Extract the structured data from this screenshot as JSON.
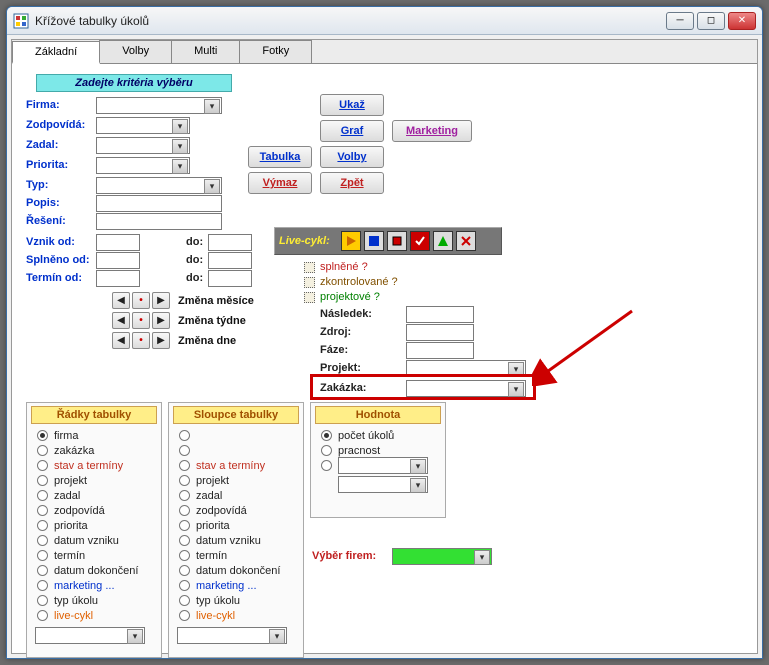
{
  "window": {
    "title": "Křížové tabulky úkolů"
  },
  "tabs": [
    "Základní",
    "Volby",
    "Multi",
    "Fotky"
  ],
  "criteria_title": "Zadejte kritéria výběru",
  "labels": {
    "firma": "Firma:",
    "zodpovida": "Zodpovídá:",
    "zadal": "Zadal:",
    "priorita": "Priorita:",
    "typ": "Typ:",
    "popis": "Popis:",
    "reseni": "Řešení:",
    "vznik_od": "Vznik od:",
    "splneno_od": "Splněno od:",
    "termin_od": "Termín od:",
    "do": "do:",
    "zmena_mesice": "Změna měsíce",
    "zmena_tydne": "Změna týdne",
    "zmena_dne": "Změna dne",
    "nasledek": "Následek:",
    "zdroj": "Zdroj:",
    "faze": "Fáze:",
    "projekt": "Projekt:",
    "zakazka": "Zakázka:",
    "splnene": "splněné ?",
    "zkontrolovane": "zkontrolované ?",
    "projektove": "projektové ?",
    "vyber_firem": "Výběr firem:"
  },
  "buttons": {
    "ukaz": "Ukaž",
    "graf": "Graf",
    "marketing": "Marketing",
    "tabulka": "Tabulka",
    "volby": "Volby",
    "vymaz": "Výmaz",
    "zpet": "Zpět"
  },
  "livecykl": "Live-cykl:",
  "rows_panel": {
    "title": "Řádky tabulky",
    "items": [
      "firma",
      "zakázka",
      "stav a termíny",
      "projekt",
      "zadal",
      "zodpovídá",
      "priorita",
      "datum vzniku",
      "termín",
      "datum dokončení",
      "marketing ...",
      "typ úkolu",
      "live-cykl"
    ]
  },
  "cols_panel": {
    "title": "Sloupce tabulky",
    "items": [
      "",
      "",
      "stav a termíny",
      "projekt",
      "zadal",
      "zodpovídá",
      "priorita",
      "datum vzniku",
      "termín",
      "datum dokončení",
      "marketing ...",
      "typ úkolu",
      "live-cykl"
    ]
  },
  "value_panel": {
    "title": "Hodnota",
    "items": [
      "počet úkolů",
      "pracnost"
    ]
  }
}
